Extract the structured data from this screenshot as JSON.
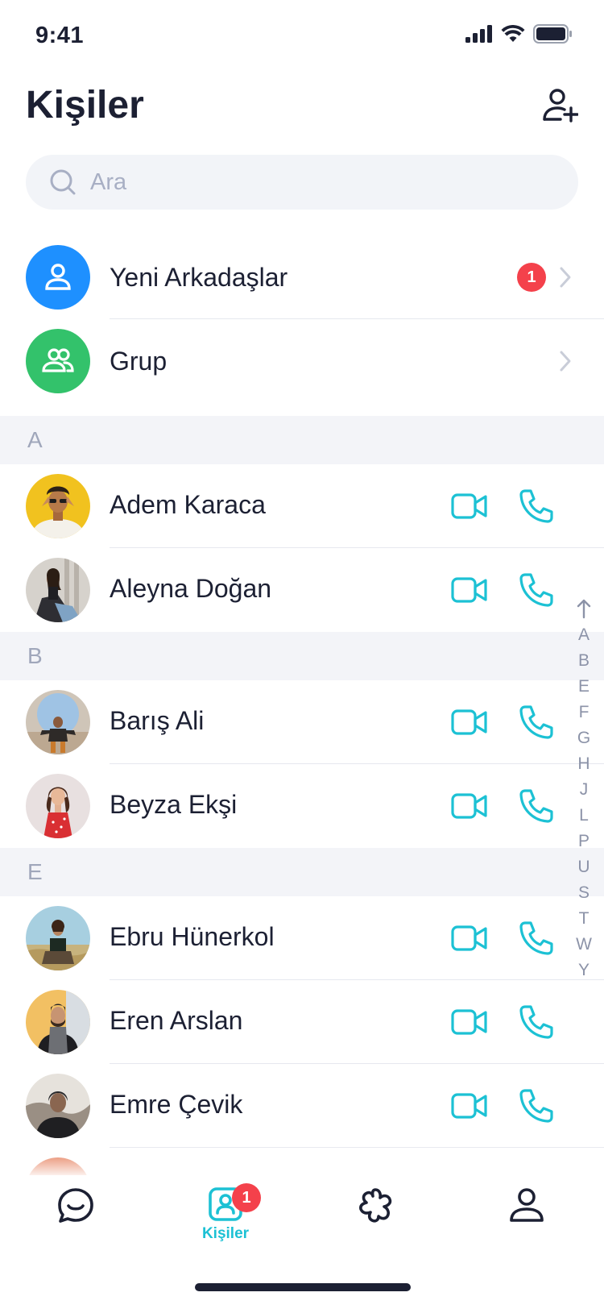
{
  "status_bar": {
    "time": "9:41"
  },
  "header": {
    "title": "Kişiler",
    "add_contact_icon": "add-user-icon"
  },
  "search": {
    "placeholder": "Ara",
    "value": ""
  },
  "special_rows": [
    {
      "label": "Yeni Arkadaşlar",
      "icon": "user-icon",
      "color": "#1e90ff",
      "badge": "1"
    },
    {
      "label": "Grup",
      "icon": "group-icon",
      "color": "#33c26b"
    }
  ],
  "sections": [
    {
      "letter": "A",
      "contacts": [
        {
          "name": "Adem Karaca"
        },
        {
          "name": "Aleyna Doğan"
        }
      ]
    },
    {
      "letter": "B",
      "contacts": [
        {
          "name": "Barış Ali"
        },
        {
          "name": "Beyza Ekşi"
        }
      ]
    },
    {
      "letter": "E",
      "contacts": [
        {
          "name": "Ebru Hünerkol"
        },
        {
          "name": "Eren Arslan"
        },
        {
          "name": "Emre Çevik"
        }
      ]
    }
  ],
  "alphabet_index": [
    "A",
    "B",
    "E",
    "F",
    "G",
    "H",
    "J",
    "L",
    "P",
    "U",
    "S",
    "T",
    "W",
    "Y"
  ],
  "tab_bar": {
    "tabs": [
      {
        "id": "chats",
        "icon": "chat-icon"
      },
      {
        "id": "contacts",
        "icon": "contacts-icon",
        "label": "Kişiler",
        "badge": "1",
        "active": true
      },
      {
        "id": "discover",
        "icon": "flower-icon"
      },
      {
        "id": "profile",
        "icon": "profile-icon"
      }
    ]
  },
  "colors": {
    "accent": "#1cc1d4",
    "badge": "#f4414b",
    "text": "#1c2033",
    "muted": "#a0a7bb"
  }
}
